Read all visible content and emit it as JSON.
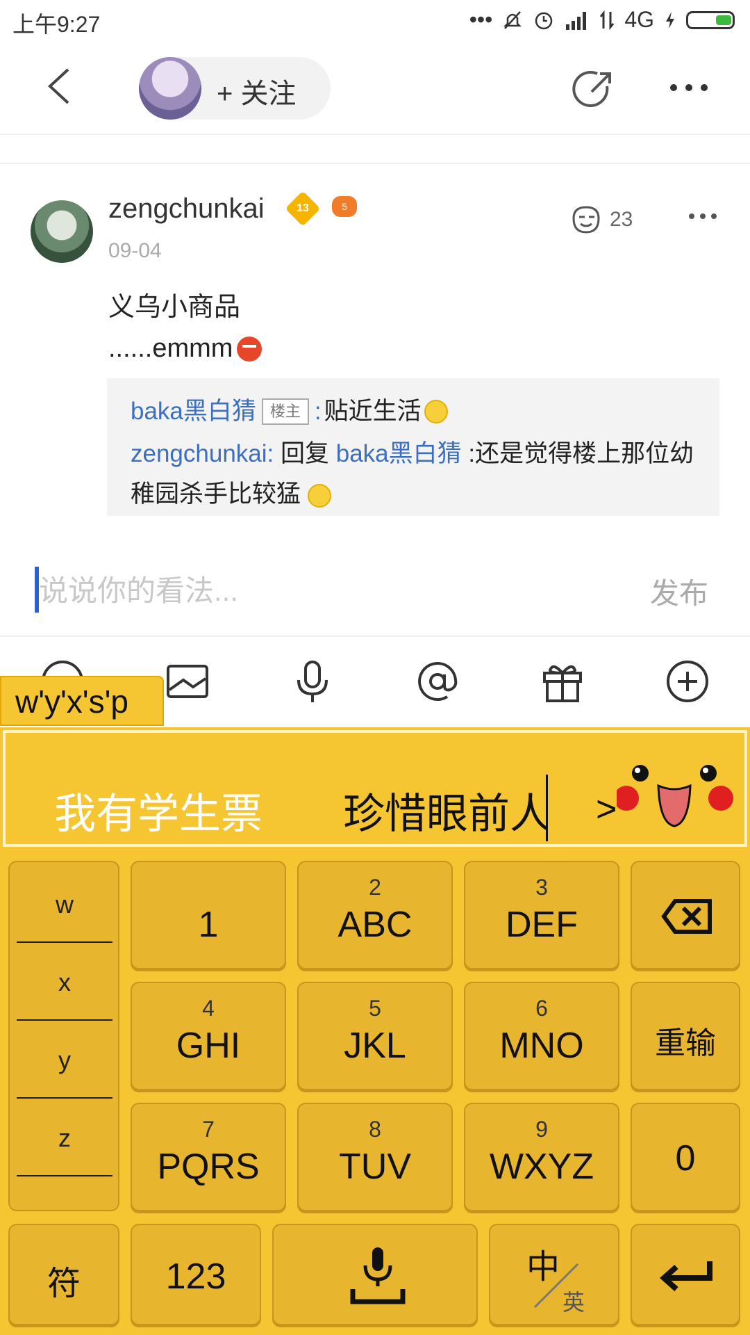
{
  "status_bar": {
    "time": "上午9:27",
    "network": "4G"
  },
  "header": {
    "follow_label": "+ 关注"
  },
  "post": {
    "username": "zengchunkai",
    "level_badge": "13",
    "game_badge": "5",
    "date": "09-04",
    "like_count": "23",
    "line1": "义乌小商品",
    "line2": "......emmm",
    "replies": {
      "r1_user": "baka黑白猜",
      "r1_tag": "楼主",
      "r1_sep": ":",
      "r1_text": "贴近生活",
      "r2_user": "zengchunkai:",
      "r2_prefix": "回复",
      "r2_target": "baka黑白猜",
      "r2_text": ":还是觉得楼上那位幼稚园杀手比较猛"
    }
  },
  "comment": {
    "placeholder": "说说你的看法...",
    "publish_label": "发布"
  },
  "toolbar": {
    "icons": [
      "emoji-icon",
      "image-icon",
      "microphone-icon",
      "at-icon",
      "gift-icon",
      "plus-icon"
    ]
  },
  "keyboard": {
    "pinyin": "w'y'x's'p",
    "candidates": [
      "我有学生票",
      "珍惜眼前人"
    ],
    "side_letters": [
      "w",
      "x",
      "y",
      "z"
    ],
    "keys": [
      {
        "num": "",
        "label": "1"
      },
      {
        "num": "2",
        "label": "ABC"
      },
      {
        "num": "3",
        "label": "DEF"
      },
      {
        "num": "4",
        "label": "GHI"
      },
      {
        "num": "5",
        "label": "JKL"
      },
      {
        "num": "6",
        "label": "MNO"
      },
      {
        "num": "7",
        "label": "PQRS"
      },
      {
        "num": "8",
        "label": "TUV"
      },
      {
        "num": "9",
        "label": "WXYZ"
      }
    ],
    "reinput_label": "重输",
    "zero_label": "0",
    "symbol_label": "符",
    "num_label": "123",
    "lang_main": "中",
    "lang_sub": "英"
  }
}
